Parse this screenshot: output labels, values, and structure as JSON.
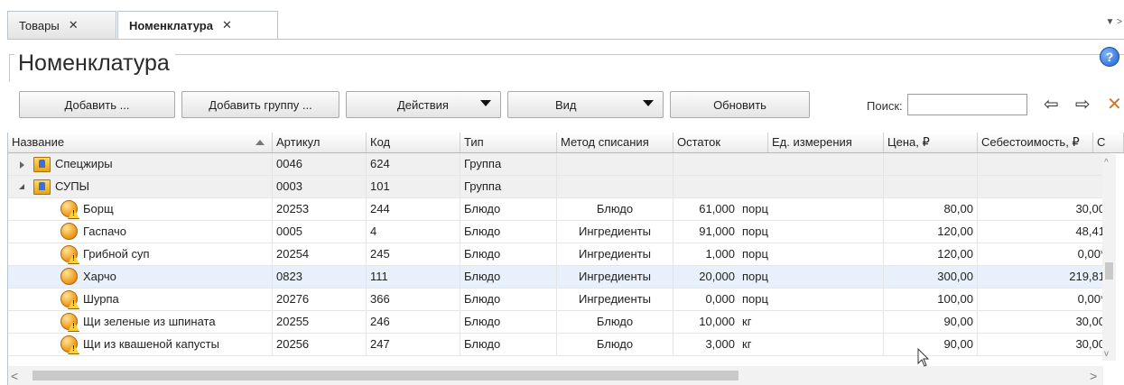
{
  "tabs": [
    {
      "label": "Товары",
      "close": "✕",
      "active": false
    },
    {
      "label": "Номенклатура",
      "close": "✕",
      "active": true
    }
  ],
  "page": {
    "title": "Номенклатура",
    "help": "?"
  },
  "toolbar": {
    "add": "Добавить ...",
    "add_group": "Добавить группу ...",
    "actions": "Действия",
    "view": "Вид",
    "refresh": "Обновить",
    "search_label": "Поиск:",
    "search_value": "",
    "prev": "⇦",
    "next": "⇨",
    "clear": "✕"
  },
  "columns": [
    "Название",
    "Артикул",
    "Код",
    "Тип",
    "Метод списания",
    "Остаток",
    "Ед. измерения",
    "Цена, ₽",
    "Себестоимость, ₽",
    "С"
  ],
  "rows": [
    {
      "kind": "group",
      "expanded": false,
      "name": "Спецжиры",
      "article": "0046",
      "code": "624",
      "type": "Группа",
      "method": "",
      "stock": "",
      "unit": "",
      "price": "",
      "cost": ""
    },
    {
      "kind": "group",
      "expanded": true,
      "name": "СУПЫ",
      "article": "0003",
      "code": "101",
      "type": "Группа",
      "method": "",
      "stock": "",
      "unit": "",
      "price": "",
      "cost": ""
    },
    {
      "kind": "item",
      "warn": true,
      "name": "Борщ",
      "article": "20253",
      "code": "244",
      "type": "Блюдо",
      "method": "Блюдо",
      "stock": "61,000",
      "unit": "порц",
      "price": "80,00",
      "cost": "30,00"
    },
    {
      "kind": "item",
      "warn": false,
      "name": "Гаспачо",
      "article": "0005",
      "code": "4",
      "type": "Блюдо",
      "method": "Ингредиенты",
      "stock": "91,000",
      "unit": "порц",
      "price": "120,00",
      "cost": "48,41"
    },
    {
      "kind": "item",
      "warn": true,
      "name": "Грибной суп",
      "article": "20254",
      "code": "245",
      "type": "Блюдо",
      "method": "Ингредиенты",
      "stock": "1,000",
      "unit": "порц",
      "price": "120,00",
      "cost": "0,00*"
    },
    {
      "kind": "item",
      "warn": false,
      "selected": true,
      "name": "Харчо",
      "article": "0823",
      "code": "111",
      "type": "Блюдо",
      "method": "Ингредиенты",
      "stock": "20,000",
      "unit": "порц",
      "price": "300,00",
      "cost": "219,81"
    },
    {
      "kind": "item",
      "warn": true,
      "name": "Шурпа",
      "article": "20276",
      "code": "366",
      "type": "Блюдо",
      "method": "Ингредиенты",
      "stock": "0,000",
      "unit": "порц",
      "price": "100,00",
      "cost": "0,00*"
    },
    {
      "kind": "item",
      "warn": true,
      "name": "Щи зеленые из шпината",
      "article": "20255",
      "code": "246",
      "type": "Блюдо",
      "method": "Блюдо",
      "stock": "10,000",
      "unit": "кг",
      "price": "90,00",
      "cost": "30,00"
    },
    {
      "kind": "item",
      "warn": true,
      "name": "Щи из квашеной капусты",
      "article": "20256",
      "code": "247",
      "type": "Блюдо",
      "method": "Блюдо",
      "stock": "3,000",
      "unit": "кг",
      "price": "90,00",
      "cost": "30,00"
    }
  ],
  "scroll": {
    "left": "<",
    "right": ">",
    "up": "^",
    "down": "v"
  },
  "colors": {
    "accent": "#d9751f",
    "border": "#b9c4cf",
    "selected_row": "#e8f1fb"
  }
}
